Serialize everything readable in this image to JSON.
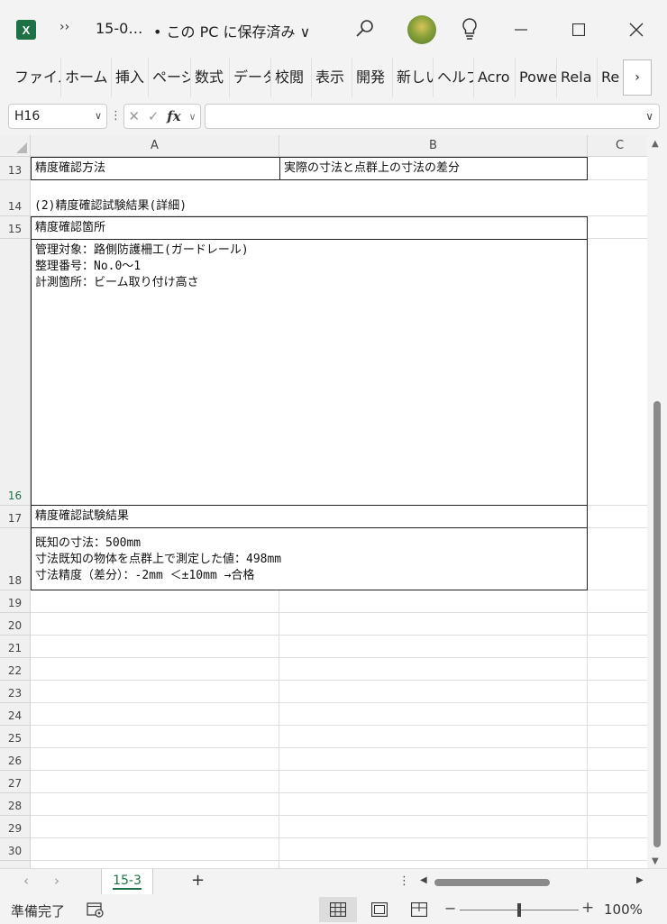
{
  "window": {
    "app_icon_letter": "X",
    "more_chev": "››",
    "file_name": "15-0…",
    "save_state": "• この PC に保存済み ∨"
  },
  "ribbon": {
    "tabs": [
      "ファイル",
      "ホーム",
      "挿入",
      "ページ",
      "数式",
      "データ",
      "校閲",
      "表示",
      "開発",
      "新しい",
      "ヘルプ",
      "Acro",
      "Powe",
      "Rela",
      "Re"
    ],
    "more": "›"
  },
  "formula_bar": {
    "name_box": "H16",
    "fx_label": "fx",
    "formula": ""
  },
  "columns": [
    "A",
    "B",
    "C"
  ],
  "rows": {
    "r13": "13",
    "r14": "14",
    "r15": "15",
    "r16": "16",
    "r17": "17",
    "r18": "18",
    "empty": [
      "19",
      "20",
      "21",
      "22",
      "23",
      "24",
      "25",
      "26",
      "27",
      "28",
      "29",
      "30"
    ]
  },
  "cells": {
    "a13": "精度確認方法",
    "b13": "実際の寸法と点群上の寸法の差分",
    "a14": "(2)精度確認試験結果(詳細)",
    "a15": "精度確認箇所",
    "a16": "管理対象：路側防護柵工(ガードレール)\n整理番号：No.0～1\n計測箇所：ビーム取り付け高さ",
    "a17": "精度確認試験結果",
    "a18": "既知の寸法：500mm\n寸法既知の物体を点群上で測定した値：498mm\n寸法精度（差分）：-2mm ＜±10mm →合格"
  },
  "sheets": {
    "active": "15-3",
    "add": "+"
  },
  "status": {
    "text": "準備完了",
    "zoom_minus": "−",
    "zoom_plus": "+",
    "zoom_level": "100%"
  }
}
